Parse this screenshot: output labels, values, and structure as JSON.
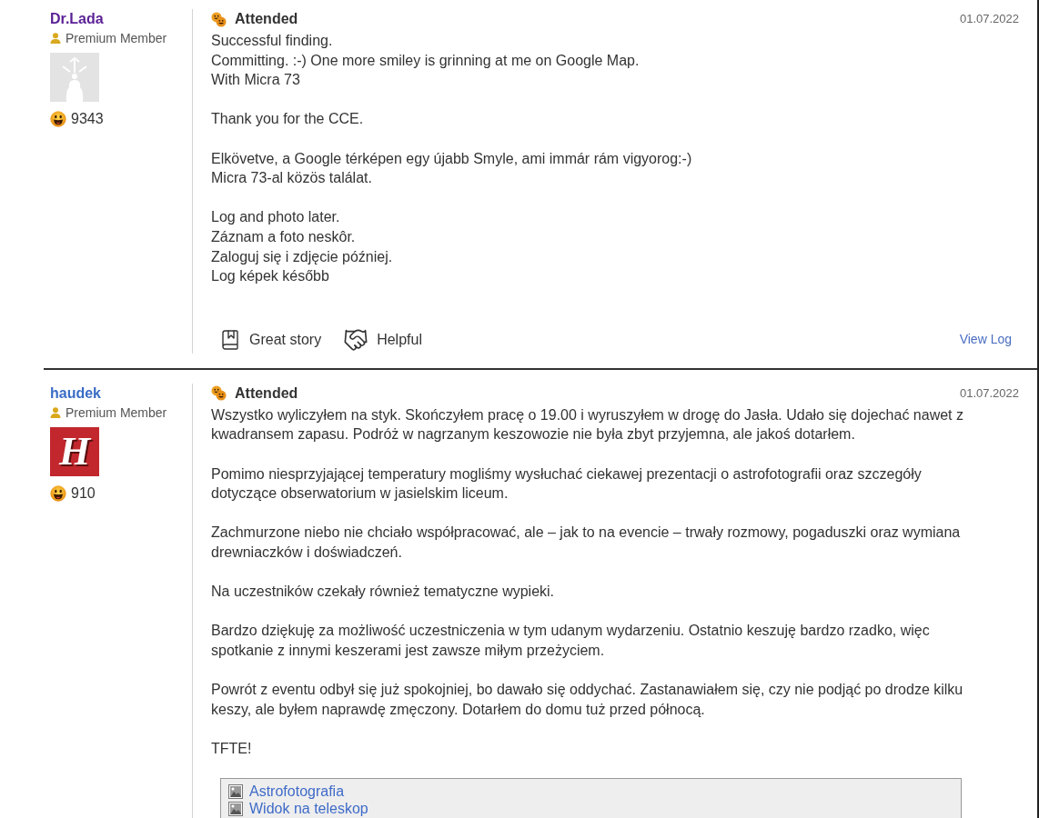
{
  "logs": [
    {
      "author": {
        "name": "Dr.Lada",
        "color": "#5b2196",
        "rank": "Premium Member",
        "avatar": {
          "kind": "default"
        },
        "finds": "9343"
      },
      "type": {
        "kind": "attended",
        "label": "Attended"
      },
      "date": "01.07.2022",
      "paragraphs": [
        "Successful finding.\nCommitting. :-) One more smiley is grinning at me on Google Map.\nWith Micra 73",
        "Thank you for the CCE.",
        "Elkövetve, a Google térképen egy újabb Smyle, ami immár rám vigyorog:-)\nMicra 73-al közös találat.",
        "Log and photo later.\nZáznam a foto neskôr.\nZaloguj się i zdjęcie później.\nLog képek később"
      ],
      "actions": [
        {
          "kind": "story",
          "label": "Great story"
        },
        {
          "kind": "helpful",
          "label": "Helpful"
        }
      ],
      "view_log": "View Log"
    },
    {
      "author": {
        "name": "haudek",
        "color": "#3a6cc6",
        "rank": "Premium Member",
        "avatar": {
          "kind": "letter",
          "text": "H"
        },
        "finds": "910"
      },
      "type": {
        "kind": "attended",
        "label": "Attended"
      },
      "date": "01.07.2022",
      "paragraphs": [
        "Wszystko wyliczyłem na styk. Skończyłem pracę o 19.00 i wyruszyłem w drogę do Jasła. Udało się dojechać nawet z kwadransem zapasu. Podróż w nagrzanym keszowozie nie była zbyt przyjemna, ale jakoś dotarłem.",
        "Pomimo niesprzyjającej temperatury mogliśmy wysłuchać ciekawej prezentacji o astrofotografii oraz szczegóły dotyczące obserwatorium w jasielskim liceum.",
        "Zachmurzone niebo nie chciało współpracować, ale – jak to na evencie – trwały rozmowy, pogaduszki oraz wymiana drewniaczków i doświadczeń.",
        "Na uczestników czekały również tematyczne wypieki.",
        "Bardzo dziękuję za możliwość uczestniczenia w tym udanym wydarzeniu. Ostatnio keszuję bardzo rzadko, więc spotkanie z innymi keszerami jest zawsze miłym przeżyciem.",
        "Powrót z eventu odbył się już spokojniej, bo dawało się oddychać. Zastanawiałem się, czy nie podjąć po drodze kilku keszy, ale byłem naprawdę zmęczony. Dotarłem do domu tuż przed północą.",
        "TFTE!"
      ],
      "gallery": [
        {
          "title": "Astrofotografia"
        },
        {
          "title": "Widok na teleskop"
        }
      ]
    }
  ]
}
